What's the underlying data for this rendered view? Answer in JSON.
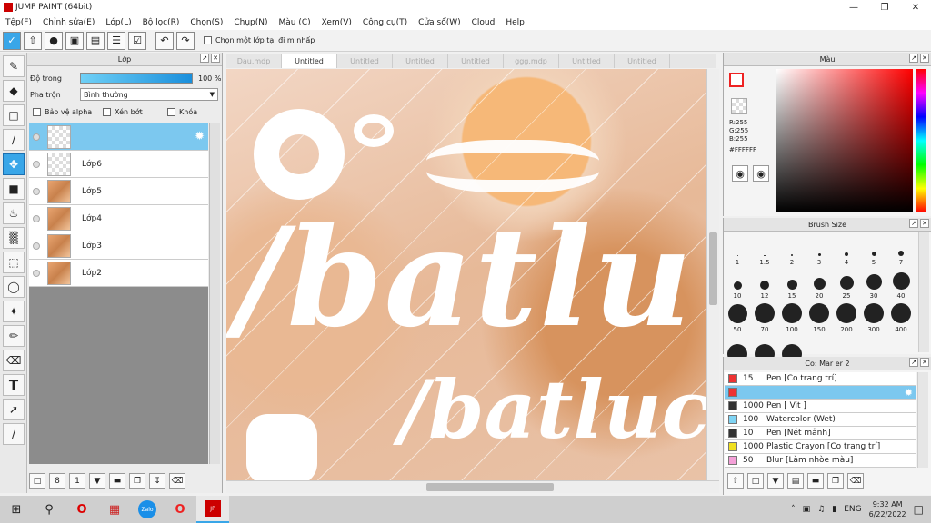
{
  "app": {
    "title": "JUMP PAINT (64bit)"
  },
  "menu": [
    "Tệp(F)",
    "Chỉnh sửa(E)",
    "Lớp(L)",
    "Bộ lọc(R)",
    "Chọn(S)",
    "Chụp(N)",
    "Màu (C)",
    "Xem(V)",
    "Công cụ(T)",
    "Cửa sổ(W)",
    "Cloud",
    "Help"
  ],
  "toolbar": {
    "option_label": "Chọn một lớp tại đi  m nhấp"
  },
  "layer_panel": {
    "title": "Lớp",
    "opacity_label": "Độ trong",
    "opacity_value": "100 %",
    "opacity_fraction": 1.0,
    "blend_label": "Pha trộn",
    "blend_value": "Bình thường",
    "protect_alpha": "Bảo vệ alpha",
    "clip": "Xén bớt",
    "lock": "Khóa",
    "layers": [
      {
        "name": ""
      },
      {
        "name": "Lớp6"
      },
      {
        "name": "Lớp5"
      },
      {
        "name": "Lớp4"
      },
      {
        "name": "Lớp3"
      },
      {
        "name": "Lớp2"
      }
    ]
  },
  "tabs": [
    "Dau.mdp",
    "Untitled",
    "Untitled",
    "Untitled",
    "Untitled",
    "ggg.mdp",
    "Untitled",
    "Untitled"
  ],
  "active_tab": 1,
  "canvas": {
    "big_text": "/batlu",
    "small_text": "/batluc"
  },
  "color_panel": {
    "title": "Màu",
    "r": "R:255",
    "g": "G:255",
    "b": "B:255",
    "hex": "#FFFFFF"
  },
  "brush_size": {
    "title": "Brush Size",
    "sizes": [
      "1",
      "1.5",
      "2",
      "3",
      "4",
      "5",
      "7",
      "10",
      "12",
      "15",
      "20",
      "25",
      "30",
      "40",
      "50",
      "70",
      "100",
      "150",
      "200",
      "300",
      "400",
      "",
      "",
      ""
    ]
  },
  "brush_panel": {
    "title": "Co: Mar  er 2",
    "brushes": [
      {
        "size": "15",
        "name": "Pen [Co trang trí]",
        "color": "#e33"
      },
      {
        "size": "",
        "name": "",
        "color": "#e33"
      },
      {
        "size": "1000",
        "name": "Pen [ Vit ]",
        "color": "#333"
      },
      {
        "size": "100",
        "name": "Watercolor (Wet)",
        "color": "#7fd4f4"
      },
      {
        "size": "10",
        "name": "Pen [Nét mảnh]",
        "color": "#333"
      },
      {
        "size": "1000",
        "name": "Plastic Crayon [Co trang trí]",
        "color": "#f0e020"
      },
      {
        "size": "50",
        "name": "Blur [Làm nhòe màu]",
        "color": "#f4a0d8"
      }
    ]
  },
  "taskbar": {
    "lang": "ENG",
    "time": "9:32 AM",
    "date": "6/22/2022"
  }
}
